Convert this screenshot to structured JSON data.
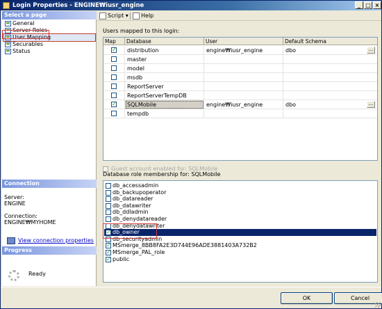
{
  "window": {
    "title": "Login Properties - ENGINE₩iusr_engine"
  },
  "left": {
    "select_page_header": "Select a page",
    "pages": [
      "General",
      "Server Roles",
      "User Mapping",
      "Securables",
      "Status"
    ],
    "selected_page": "User Mapping",
    "connection_header": "Connection",
    "server_label": "Server:",
    "server_value": "ENGINE",
    "connection_label": "Connection:",
    "connection_value": "ENGINE₩MYHOME",
    "view_connection_link": "View connection properties",
    "progress_header": "Progress",
    "progress_status": "Ready"
  },
  "toolbar": {
    "script_label": "Script",
    "script_arrow": "▾",
    "help_label": "Help"
  },
  "users_mapped": {
    "caption": "Users mapped to this login:",
    "columns": [
      "Map",
      "Database",
      "User",
      "Default Schema"
    ],
    "rows": [
      {
        "map": true,
        "database": "distribution",
        "user": "engine₩iusr_engine",
        "schema": "dbo",
        "selected": false
      },
      {
        "map": false,
        "database": "master",
        "user": "",
        "schema": "",
        "selected": false
      },
      {
        "map": false,
        "database": "model",
        "user": "",
        "schema": "",
        "selected": false
      },
      {
        "map": false,
        "database": "msdb",
        "user": "",
        "schema": "",
        "selected": false
      },
      {
        "map": false,
        "database": "ReportServer",
        "user": "",
        "schema": "",
        "selected": false
      },
      {
        "map": false,
        "database": "ReportServerTempDB",
        "user": "",
        "schema": "",
        "selected": false
      },
      {
        "map": true,
        "database": "SQLMobile",
        "user": "engine₩iusr_engine",
        "schema": "dbo",
        "selected": true
      },
      {
        "map": false,
        "database": "tempdb",
        "user": "",
        "schema": "",
        "selected": false
      }
    ],
    "ellipsis_label": "..."
  },
  "guest_account": {
    "label": "Guest account enabled for: SQLMobile",
    "checked": false,
    "enabled": false
  },
  "role_membership": {
    "caption": "Database role membership for: SQLMobile",
    "roles": [
      {
        "name": "db_accessadmin",
        "checked": false,
        "selected": false
      },
      {
        "name": "db_backupoperator",
        "checked": false,
        "selected": false
      },
      {
        "name": "db_datareader",
        "checked": false,
        "selected": false
      },
      {
        "name": "db_datawriter",
        "checked": false,
        "selected": false
      },
      {
        "name": "db_ddladmin",
        "checked": false,
        "selected": false
      },
      {
        "name": "db_denydatareader",
        "checked": false,
        "selected": false
      },
      {
        "name": "db_denydatawriter",
        "checked": false,
        "selected": false
      },
      {
        "name": "db_owner",
        "checked": true,
        "selected": true
      },
      {
        "name": "db_securityadmin",
        "checked": false,
        "selected": false
      },
      {
        "name": "MSmerge_8BB8FA2E3D744E96ADE3881403A732B2",
        "checked": true,
        "selected": false
      },
      {
        "name": "MSmerge_PAL_role",
        "checked": true,
        "selected": false
      },
      {
        "name": "public",
        "checked": true,
        "selected": false
      }
    ]
  },
  "buttons": {
    "ok": "OK",
    "cancel": "Cancel"
  },
  "title_buttons": {
    "minimize": "_",
    "maximize": "□",
    "close": "×"
  },
  "check_mark": "✓",
  "colors": {
    "title_bar": "#0a246a",
    "selection": "#0a246a",
    "highlight_box": "#d23b3b",
    "link": "#0000cc"
  }
}
